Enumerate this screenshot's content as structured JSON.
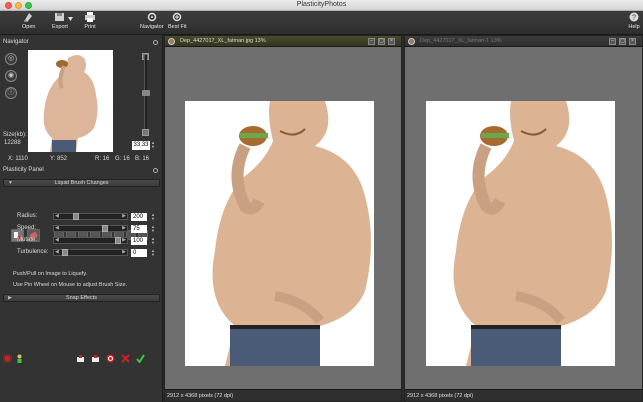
{
  "window": {
    "title": "PlasticityPhotos"
  },
  "toolbar": {
    "open": "Open",
    "export": "Export",
    "print": "Print",
    "navigator": "Navigator",
    "best_fit": "Best Fit",
    "help": "Help"
  },
  "navigator": {
    "title": "Navigator",
    "zoom": "33.33",
    "size_label": "Size(kb):",
    "size_value": "12288",
    "x": "X: 1110",
    "y": "Y: 852",
    "r": "R: 16",
    "g": "G: 16",
    "b": "B: 16"
  },
  "plasticity": {
    "title": "Plasticity Panel",
    "liquid_title": "Liquid Brush Changes",
    "snap_title": "Snap Effects",
    "sliders": [
      {
        "label": "Radius:",
        "value": "200",
        "level": 0.2
      },
      {
        "label": "Speed:",
        "value": "75",
        "level": 0.75
      },
      {
        "label": "Mutate:",
        "value": "100",
        "level": 1.0
      },
      {
        "label": "Turbulence:",
        "value": "0",
        "level": 0.0
      }
    ],
    "hint1": "Push/Pull on Image to Liquefy.",
    "hint2": "Use Pin Wheel on Mouse to adjust Brush Size."
  },
  "left_pane": {
    "filename": "Dep_4427017_XL_fatman.jpg 13%",
    "footer": "2912 x 4368 pixels (72 dpi)"
  },
  "right_pane": {
    "filename": "Dep_4427017_XL_fatman-1 13%",
    "footer": "2912 x 4368 pixels (72 dpi)"
  },
  "colors": {
    "accent_green": "#3ec43e",
    "accent_red": "#d02020",
    "toolbar_bg": "#333333",
    "canvas_bg": "#6f6f6f"
  }
}
